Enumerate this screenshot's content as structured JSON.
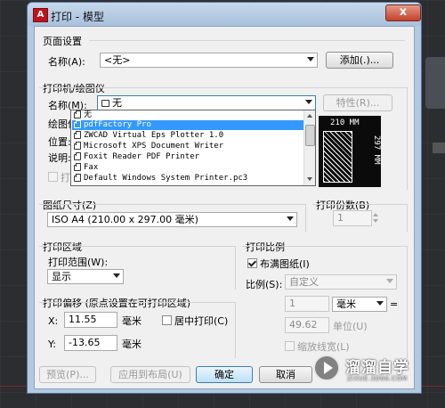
{
  "window": {
    "title": "打印 - 模型",
    "app_icon": "A",
    "close_label": "x"
  },
  "page_setup": {
    "group_label": "页面设置",
    "name_label": "名称(A):",
    "name_value": "<无>",
    "add_button": "添加(.)..."
  },
  "printer": {
    "group_label": "打印机/绘图仪",
    "name_label": "名称(M):",
    "name_value": "无",
    "properties_button": "特性(R)...",
    "plotter_label": "绘图仪:",
    "location_label": "位置:",
    "description_label": "说明:",
    "print_to_file_label": "打印到文件",
    "dropdown_items": [
      "无",
      "pdfFactory Pro",
      "ZWCAD Virtual Eps Plotter 1.0",
      "Microsoft XPS Document Writer",
      "Foxit Reader PDF Printer",
      "Fax",
      "Default Windows System Printer.pc3"
    ],
    "selected_index": 1,
    "preview_width": "210 MM",
    "preview_height": "297 MM"
  },
  "paper_size": {
    "label": "图纸尺寸(Z)",
    "value": "ISO A4 (210.00 x 297.00 毫米)"
  },
  "copies": {
    "label": "打印份数(B)",
    "value": "1"
  },
  "print_area": {
    "group_label": "打印区域",
    "range_label": "打印范围(W):",
    "range_value": "显示"
  },
  "print_offset": {
    "group_label": "打印偏移 (原点设置在可打印区域)",
    "x_label": "X:",
    "x_value": "11.55",
    "y_label": "Y:",
    "y_value": "-13.65",
    "unit": "毫米",
    "center_label": "居中打印(C)"
  },
  "print_scale": {
    "group_label": "打印比例",
    "fit_label": "布满图纸(I)",
    "fit_checked": true,
    "scale_label": "比例(S):",
    "scale_value": "自定义",
    "value1": "1",
    "unit1": "毫米",
    "equals": "=",
    "value2": "49.62",
    "unit2": "单位(U)",
    "lineweight_label": "缩放线宽(L)"
  },
  "footer": {
    "preview_button": "预览(P)...",
    "apply_button": "应用到布局(U)",
    "ok_button": "确定",
    "cancel_button": "取消"
  },
  "watermark": {
    "text": "溜溜自学",
    "sub": "ZIXUE.3D66.COM"
  }
}
